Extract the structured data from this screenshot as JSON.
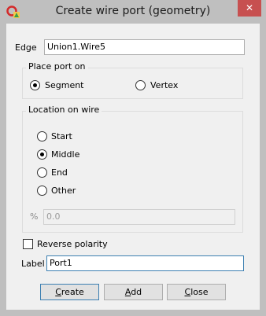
{
  "window": {
    "title": "Create wire port (geometry)",
    "close_glyph": "✕",
    "close_color": "#c75050"
  },
  "edge": {
    "label": "Edge",
    "value": "Union1.Wire5"
  },
  "place_port_on": {
    "title": "Place port on",
    "options": [
      {
        "label": "Segment",
        "checked": true
      },
      {
        "label": "Vertex",
        "checked": false
      }
    ]
  },
  "location": {
    "title": "Location on wire",
    "options": [
      {
        "label": "Start",
        "checked": false
      },
      {
        "label": "Middle",
        "checked": true
      },
      {
        "label": "End",
        "checked": false
      },
      {
        "label": "Other",
        "checked": false
      }
    ],
    "percent_symbol": "%",
    "percent_value": "0.0"
  },
  "reverse_polarity": {
    "label": "Reverse polarity",
    "checked": false
  },
  "port_label": {
    "label": "Label",
    "value": "Port1"
  },
  "buttons": {
    "create": {
      "mnemonic": "C",
      "rest": "reate"
    },
    "add": {
      "mnemonic": "A",
      "rest": "dd"
    },
    "close": {
      "mnemonic": "C",
      "rest": "lose"
    }
  }
}
